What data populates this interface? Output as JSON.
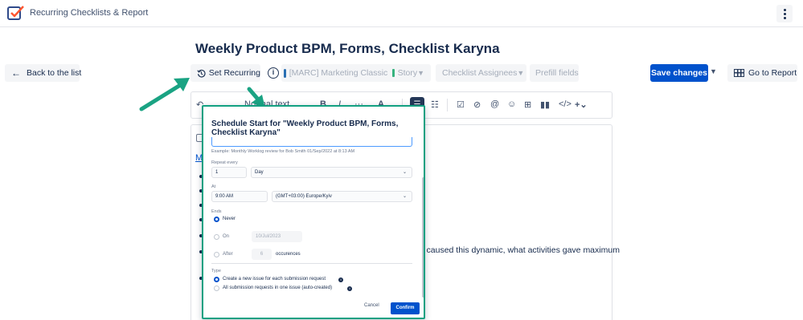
{
  "app": {
    "title": "Recurring Checklists & Report"
  },
  "page": {
    "title": "Weekly Product BPM, Forms, Checklist Karyna"
  },
  "toolbar": {
    "back_label": "Back to the list",
    "set_recurring_label": "Set Recurring",
    "info_glyph": "i",
    "project_value": "[MARC] Marketing Classic",
    "issue_type_value": "Story",
    "assignees_label": "Checklist Assignees",
    "prefill_label": "Prefill fields",
    "save_label": "Save changes",
    "report_label": "Go to Report"
  },
  "editor": {
    "format_label": "Normal text",
    "link_text": "Mo",
    "visible_text": "hat caused this dynamic, what activities gave maximum"
  },
  "modal": {
    "title": "Schedule Start for \"Weekly Product BPM, Forms, Checklist Karyna\"",
    "hint": "Example: Monthly Worklog review for Bob Smith 01/Sep/2022 at 8:13 AM",
    "repeat_every_label": "Repeat every",
    "repeat_every_value": "1",
    "repeat_unit_value": "Day",
    "at_label": "At",
    "at_time_value": "9:00 AM",
    "timezone_value": "(GMT+03:00) Europe/Kyiv",
    "ends_label": "Ends",
    "ends_never_label": "Never",
    "ends_on_label": "On",
    "ends_on_value": "10/Jul/2023",
    "ends_after_label": "After",
    "ends_after_value": "6",
    "occurrences_label": "occurences",
    "type_label": "Type",
    "type_option_1": "Create a new issue for each submission request",
    "type_option_2": "All submission requests in one issue (auto-created)",
    "cancel_label": "Cancel",
    "confirm_label": "Confirm"
  },
  "colors": {
    "primary": "#0052cc",
    "highlight_border": "#12a081",
    "annotation_arrow": "#1aa383"
  },
  "icons": [
    "checklist-logo-icon",
    "kebab-menu-icon",
    "arrow-left-icon",
    "history-icon",
    "info-icon",
    "project-icon",
    "story-icon",
    "chevron-down-icon",
    "table-icon"
  ]
}
